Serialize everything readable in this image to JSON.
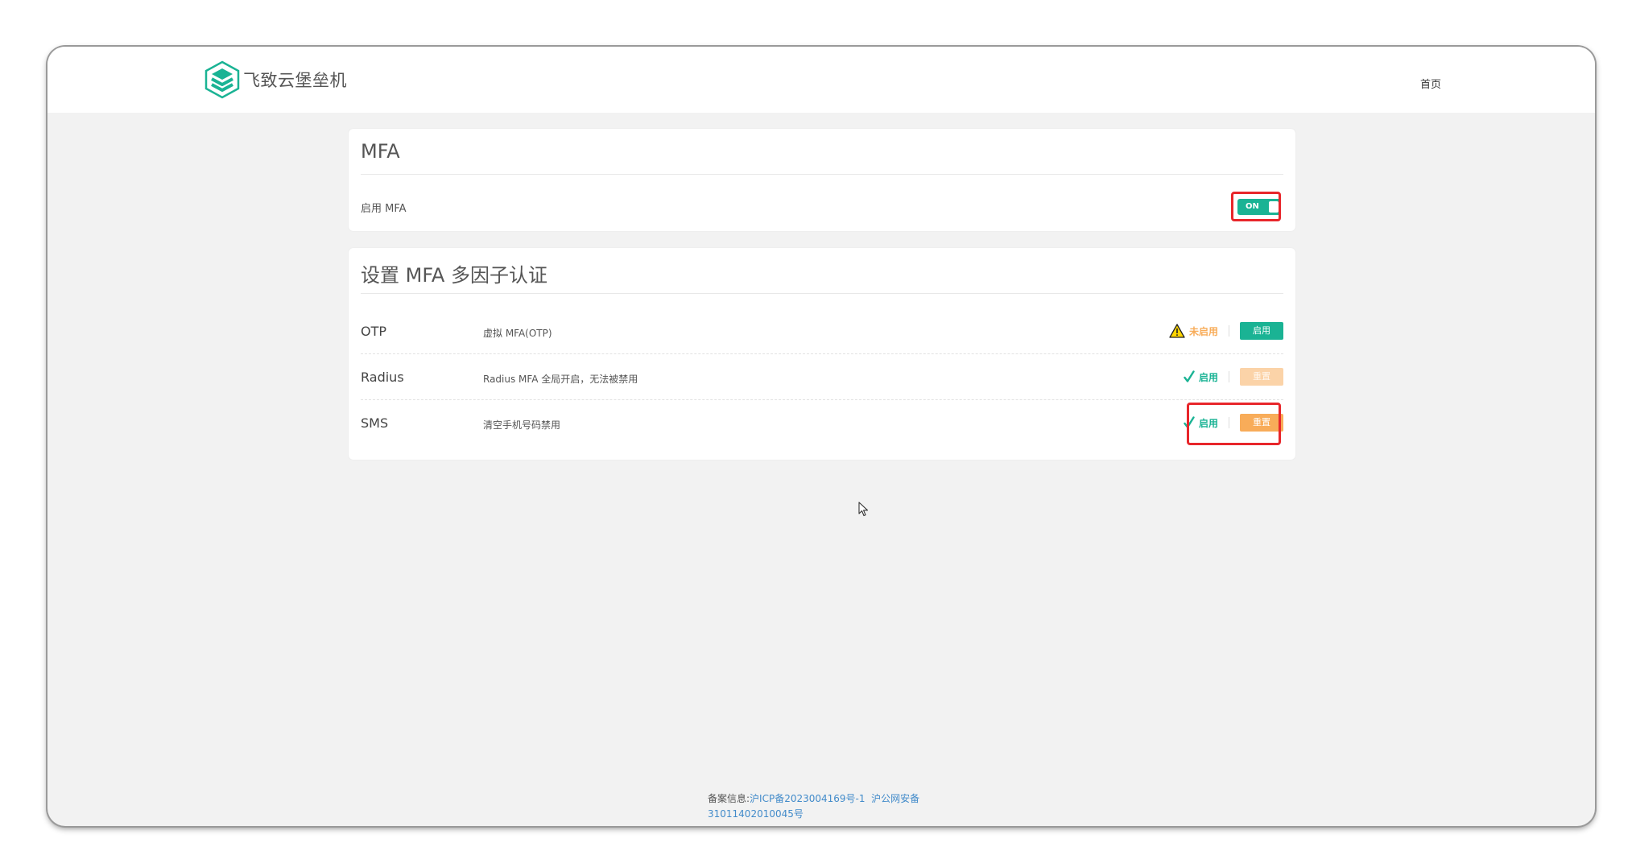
{
  "header": {
    "app_name": "飞致云堡垒机",
    "nav_home": "首页"
  },
  "mfa_card": {
    "title": "MFA",
    "enable_label": "启用 MFA",
    "toggle": {
      "state_label": "ON",
      "enabled": true
    }
  },
  "setup_card": {
    "title": "设置 MFA 多因子认证",
    "rows": [
      {
        "name": "OTP",
        "description": "虚拟 MFA(OTP)",
        "status": "未启用",
        "status_type": "warning",
        "action": "启用",
        "action_state": "primary"
      },
      {
        "name": "Radius",
        "description": "Radius MFA 全局开启，无法被禁用",
        "status": "启用",
        "status_type": "ok",
        "action": "重置",
        "action_state": "disabled"
      },
      {
        "name": "SMS",
        "description": "清空手机号码禁用",
        "status": "启用",
        "status_type": "ok",
        "action": "重置",
        "action_state": "warning"
      }
    ]
  },
  "footer": {
    "prefix": "备案信息:",
    "icp_link": "沪ICP备2023004169号-1",
    "police_link_line1": "沪公网安备",
    "police_link_line2": "31011402010045号"
  },
  "colors": {
    "primary": "#1ab394",
    "warning": "#f8ac59",
    "highlight": "#e8262b",
    "link": "#428bca"
  }
}
